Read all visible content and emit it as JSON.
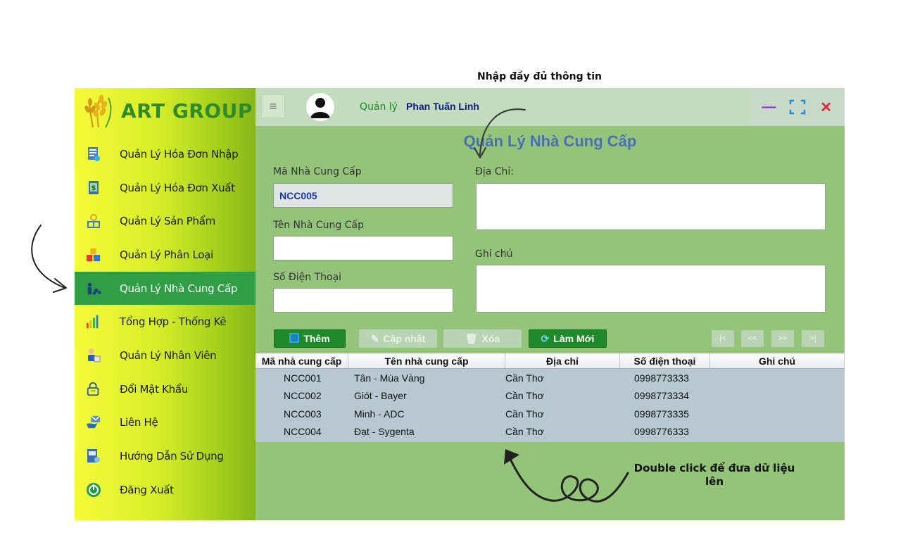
{
  "annotations": {
    "top": "Nhập đầy đủ thông tin",
    "bottom": "Double click để đưa dữ liệu lên"
  },
  "sidebar": {
    "logo_text": "ART GROUP",
    "items": [
      {
        "label": "Quản Lý Hóa Đơn Nhập",
        "icon": "import-invoice-icon"
      },
      {
        "label": "Quản Lý Hóa Đơn Xuất",
        "icon": "export-invoice-icon"
      },
      {
        "label": "Quản Lý Sản Phẩm",
        "icon": "product-icon"
      },
      {
        "label": "Quản Lý Phân Loại",
        "icon": "category-icon"
      },
      {
        "label": "Quản Lý Nhà Cung Cấp",
        "icon": "supplier-icon",
        "active": true
      },
      {
        "label": "Tổng Hợp - Thống Kê",
        "icon": "statistics-icon"
      },
      {
        "label": "Quản Lý Nhân Viên",
        "icon": "employee-icon"
      },
      {
        "label": "Đổi Mật Khẩu",
        "icon": "password-icon"
      },
      {
        "label": "Liên Hệ",
        "icon": "contact-icon"
      },
      {
        "label": "Hướng Dẫn Sử Dụng",
        "icon": "guide-icon"
      },
      {
        "label": "Đăng Xuất",
        "icon": "logout-icon"
      }
    ]
  },
  "header": {
    "role": "Quản lý",
    "user": "Phan Tuấn Linh"
  },
  "form": {
    "title": "Quản Lý Nhà Cung Cấp",
    "code_label": "Mã Nhà Cung Cấp",
    "code_value": "NCC005",
    "name_label": "Tên Nhà Cung Cấp",
    "name_value": "",
    "phone_label": "Số Điện Thoại",
    "phone_value": "",
    "address_label": "Địa Chỉ:",
    "address_value": "",
    "note_label": "Ghi chú",
    "note_value": ""
  },
  "actions": {
    "add": "Thêm",
    "update": "Cập nhật",
    "delete": "Xóa",
    "refresh": "Làm Mới",
    "first": "|<",
    "prev": "<<",
    "next": ">>",
    "last": ">|"
  },
  "table": {
    "headers": [
      "Mã nhà cung cấp",
      "Tên nhà cung cấp",
      "Địa chỉ",
      "Số điện thoại",
      "Ghi chú"
    ],
    "rows": [
      [
        "NCC001",
        "Tân - Mùa Vàng",
        "Cần Thơ",
        "0998773333",
        ""
      ],
      [
        "NCC002",
        "Gi­ót - Bayer",
        "Cần Thơ",
        "0998773334",
        ""
      ],
      [
        "NCC003",
        "Minh - ADC",
        "Cần Thơ",
        "0998773335",
        ""
      ],
      [
        "NCC004",
        "Đạt - Sygenta",
        "Cần Thơ",
        "0998776333",
        ""
      ]
    ]
  }
}
